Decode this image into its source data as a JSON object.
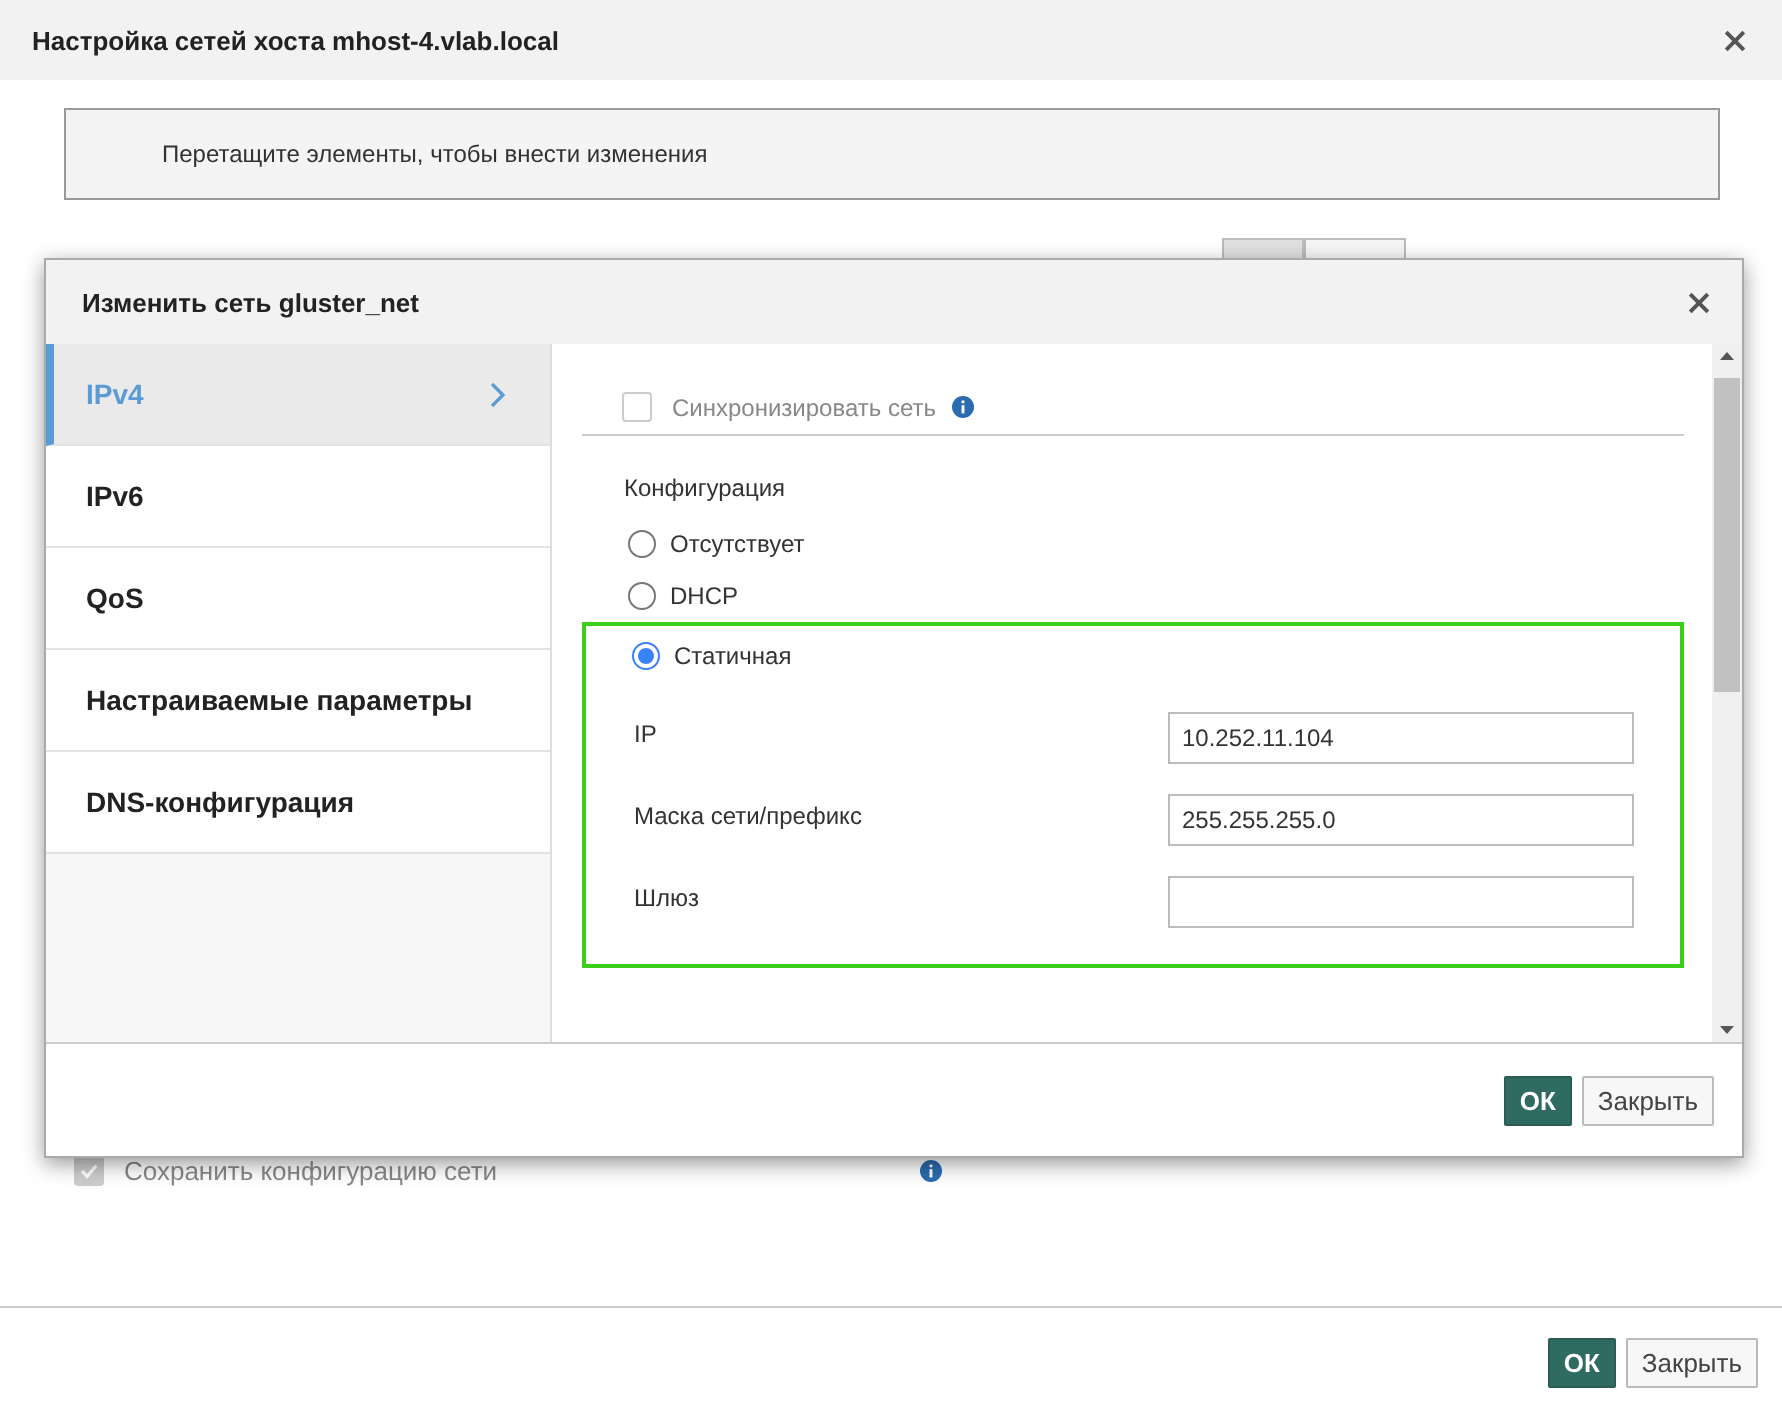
{
  "window": {
    "title": "Настройка сетей хоста mhost-4.vlab.local"
  },
  "hint": "Перетащите элементы, чтобы внести изменения",
  "toggle": [
    {
      "selected": true
    },
    {
      "selected": false
    }
  ],
  "save_config": {
    "label": "Сохранить конфигурацию сети",
    "checked": true,
    "disabled": true
  },
  "buttons": [
    {
      "label": "ОК",
      "kind": "primary"
    },
    {
      "label": "Закрыть",
      "kind": "default"
    }
  ],
  "modal": {
    "title": "Изменить сеть gluster_net",
    "tabs": [
      {
        "label": "IPv4",
        "selected": true
      },
      {
        "label": "IPv6",
        "selected": false
      },
      {
        "label": "QoS",
        "selected": false
      },
      {
        "label": "Настраиваемые параметры",
        "selected": false
      },
      {
        "label": "DNS-конфигурация",
        "selected": false
      }
    ],
    "sync": {
      "label": "Синхронизировать сеть",
      "checked": false,
      "disabled": true
    },
    "config_label": "Конфигурация",
    "options": [
      {
        "label": "Отсутствует",
        "selected": false
      },
      {
        "label": "DHCP",
        "selected": false
      },
      {
        "label": "Статичная",
        "selected": true
      }
    ],
    "fields": [
      {
        "label": "IP",
        "value": "10.252.11.104"
      },
      {
        "label": "Маска сети/префикс",
        "value": "255.255.255.0"
      },
      {
        "label": "Шлюз"
      }
    ],
    "buttons": [
      {
        "label": "ОК",
        "kind": "primary"
      },
      {
        "label": "Закрыть",
        "kind": "default"
      }
    ]
  }
}
